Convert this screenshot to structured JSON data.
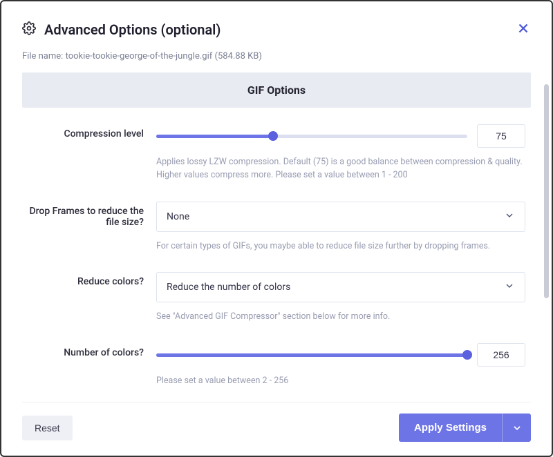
{
  "header": {
    "title": "Advanced Options (optional)"
  },
  "file": {
    "label": "File name:",
    "name": "tookie-tookie-george-of-the-jungle.gif",
    "size": "(584.88 KB)"
  },
  "section": {
    "title": "GIF Options"
  },
  "compression": {
    "label": "Compression level",
    "value": "75",
    "fill_percent": 37.5,
    "hint": "Applies lossy LZW compression. Default (75) is a good balance between compression & quality. Higher values compress more. Please set a value between 1 - 200"
  },
  "drop_frames": {
    "label": "Drop Frames to reduce the file size?",
    "selected": "None",
    "hint": "For certain types of GIFs, you maybe able to reduce file size further by dropping frames."
  },
  "reduce_colors": {
    "label": "Reduce colors?",
    "selected": "Reduce the number of colors",
    "hint": "See \"Advanced GIF Compressor\" section below for more info."
  },
  "num_colors": {
    "label": "Number of colors?",
    "value": "256",
    "fill_percent": 100,
    "hint": "Please set a value between 2 - 256"
  },
  "footer": {
    "reset": "Reset",
    "apply": "Apply Settings"
  }
}
